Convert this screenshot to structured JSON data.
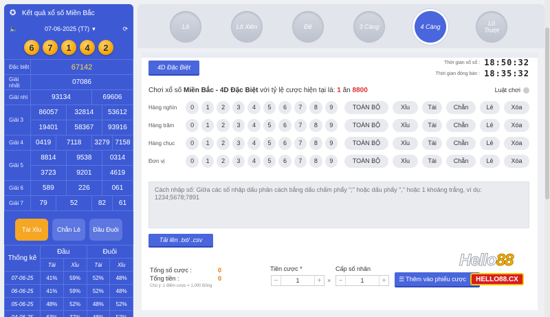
{
  "left": {
    "title": "Kết quả xổ số Miền Bắc",
    "date": "07-06-2025 (T7)",
    "balls": [
      "6",
      "7",
      "1",
      "4",
      "2"
    ],
    "results": {
      "special": {
        "label": "Đặc biệt",
        "values": [
          "67142"
        ]
      },
      "first": {
        "label": "Giải nhất",
        "values": [
          "07086"
        ]
      },
      "second": {
        "label": "Giải nhì",
        "values": [
          "93134",
          "69606"
        ]
      },
      "third": {
        "label": "Giải 3",
        "values": [
          "86057",
          "32814",
          "53612",
          "19401",
          "58367",
          "93916"
        ]
      },
      "fourth": {
        "label": "Giải 4",
        "values": [
          "0419",
          "7118",
          "3279",
          "7158"
        ]
      },
      "fifth": {
        "label": "Giải 5",
        "values": [
          "8814",
          "9538",
          "0314",
          "3723",
          "9201",
          "4619"
        ]
      },
      "sixth": {
        "label": "Giải 6",
        "values": [
          "589",
          "226",
          "061"
        ]
      },
      "seventh": {
        "label": "Giải 7",
        "values": [
          "79",
          "52",
          "82",
          "61"
        ]
      }
    },
    "tabs": [
      "Tài Xỉu",
      "Chẵn Lẻ",
      "Đầu Đuôi"
    ],
    "stats": {
      "title": "Thống kê",
      "head_group": [
        "Đầu",
        "Đuôi"
      ],
      "subhead": [
        "Tài",
        "Xỉu",
        "Tài",
        "Xỉu"
      ],
      "rows": [
        {
          "date": "07-06-25",
          "vals": [
            "41%",
            "59%",
            "52%",
            "48%"
          ]
        },
        {
          "date": "06-06-25",
          "vals": [
            "41%",
            "59%",
            "52%",
            "48%"
          ]
        },
        {
          "date": "05-06-25",
          "vals": [
            "48%",
            "52%",
            "48%",
            "52%"
          ]
        },
        {
          "date": "04-06-25",
          "vals": [
            "63%",
            "37%",
            "48%",
            "52%"
          ]
        }
      ]
    }
  },
  "toptabs": [
    "Lô",
    "Lô Xiên",
    "Đề",
    "3 Càng",
    "4 Càng",
    "Lô Trượt"
  ],
  "main": {
    "type_button": "4D Đặc Biệt",
    "timer1_label": "Thời gian xổ số :",
    "timer1": "18:50:32",
    "timer2_label": "Thời gian đóng bán :",
    "timer2": "18:35:32",
    "rate_prefix": "Chơi xổ số ",
    "rate_bold": "Miền Bắc - 4D Đặc Biệt",
    "rate_mid": " với tỷ lệ cược hiện tại là: ",
    "rate_one": "1",
    "rate_an": " ăn ",
    "rate_value": "8800",
    "rules": "Luật chơi",
    "row_labels": [
      "Hàng nghìn",
      "Hàng trăm",
      "Hàng chục",
      "Đơn vị"
    ],
    "digits": [
      "0",
      "1",
      "2",
      "3",
      "4",
      "5",
      "6",
      "7",
      "8",
      "9"
    ],
    "actions": [
      "TOÀN BỘ",
      "Xỉu",
      "Tài",
      "Chẵn",
      "Lẻ",
      "Xóa"
    ],
    "note": "Cách nhập số: Giữa các số nhập dấu phân cách bằng dấu chấm phẩy \";\" hoặc dấu phẩy \",\" hoặc 1 khoảng trắng, ví dụ: 1234;5678;7891",
    "upload": "Tải lên .txt/ .csv",
    "total_bets_label": "Tổng số cược :",
    "total_bets": "0",
    "total_money_label": "Tổng tiền :",
    "total_money": "0",
    "hint": "Chú ý: 1 điểm cược = 1,000 Đồng",
    "bet_label": "Tiền cược *",
    "bet_value": "1",
    "mult_label": "Cấp số nhân",
    "mult_value": "1",
    "times": "×",
    "add_button": "Thêm vào phiếu cược"
  },
  "logo": {
    "word_a": "Hello",
    "word_b": "88",
    "badge": "HELLO88.CX"
  }
}
